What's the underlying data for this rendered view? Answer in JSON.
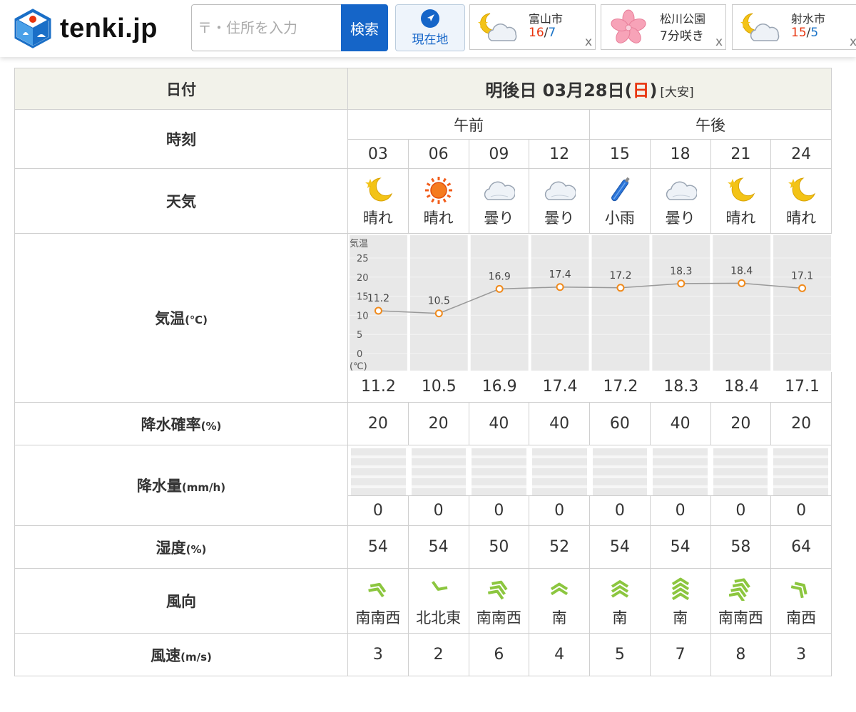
{
  "header": {
    "logo_text": "tenki.jp",
    "search": {
      "placeholder": "〒・住所を入力",
      "button_label": "検索"
    },
    "location_button_label": "現在地",
    "favorites": [
      {
        "name": "富山市",
        "high": "16",
        "sep": "/",
        "low": "7",
        "close": "x",
        "icon": "moon-cloud-icon"
      },
      {
        "name": "松川公園",
        "status": "7分咲き",
        "close": "x",
        "icon": "cherry-blossom-icon"
      },
      {
        "name": "射水市",
        "high": "15",
        "sep": "/",
        "low": "5",
        "close": "x",
        "icon": "moon-cloud-icon"
      }
    ]
  },
  "table": {
    "labels": {
      "date": "日付",
      "time": "時刻",
      "weather": "天気",
      "temp": "気温",
      "temp_unit": "(℃)",
      "precip_prob": "降水確率",
      "precip_prob_unit": "(%)",
      "precip_amount": "降水量",
      "precip_amount_unit": "(mm/h)",
      "humidity": "湿度",
      "humidity_unit": "(%)",
      "wind_dir": "風向",
      "wind_speed": "風速",
      "wind_speed_unit": "(m/s)"
    },
    "date": {
      "prefix": "明後日 03月28日(",
      "weekday": "日",
      "suffix": ")",
      "rokuyo": "[大安]"
    },
    "am_label": "午前",
    "pm_label": "午後",
    "hours": [
      "03",
      "06",
      "09",
      "12",
      "15",
      "18",
      "21",
      "24"
    ],
    "weather": [
      {
        "text": "晴れ",
        "icon": "moon-icon"
      },
      {
        "text": "晴れ",
        "icon": "sun-icon"
      },
      {
        "text": "曇り",
        "icon": "cloud-icon"
      },
      {
        "text": "曇り",
        "icon": "cloud-icon"
      },
      {
        "text": "小雨",
        "icon": "umbrella-icon"
      },
      {
        "text": "曇り",
        "icon": "cloud-icon"
      },
      {
        "text": "晴れ",
        "icon": "moon-icon"
      },
      {
        "text": "晴れ",
        "icon": "moon-icon"
      }
    ],
    "temps": [
      "11.2",
      "10.5",
      "16.9",
      "17.4",
      "17.2",
      "18.3",
      "18.4",
      "17.1"
    ],
    "precip_prob": [
      "20",
      "20",
      "40",
      "40",
      "60",
      "40",
      "20",
      "20"
    ],
    "precip_amount": [
      "0",
      "0",
      "0",
      "0",
      "0",
      "0",
      "0",
      "0"
    ],
    "humidity": [
      "54",
      "54",
      "50",
      "52",
      "54",
      "54",
      "58",
      "64"
    ],
    "wind_dir": [
      {
        "text": "南南西",
        "icon": "wind-arrow-icon",
        "strength": 3
      },
      {
        "text": "北北東",
        "icon": "wind-arrow-icon",
        "strength": 2
      },
      {
        "text": "南南西",
        "icon": "wind-arrow-icon",
        "strength": 6
      },
      {
        "text": "南",
        "icon": "wind-arrow-icon",
        "strength": 4
      },
      {
        "text": "南",
        "icon": "wind-arrow-icon",
        "strength": 5
      },
      {
        "text": "南",
        "icon": "wind-arrow-icon",
        "strength": 7
      },
      {
        "text": "南南西",
        "icon": "wind-arrow-icon",
        "strength": 8
      },
      {
        "text": "南西",
        "icon": "wind-arrow-icon",
        "strength": 3
      }
    ],
    "wind_speed": [
      "3",
      "2",
      "6",
      "4",
      "5",
      "7",
      "8",
      "3"
    ]
  },
  "chart_data": {
    "type": "line",
    "title": "",
    "ylabel": "気温",
    "yunit": "(℃)",
    "categories": [
      "03",
      "06",
      "09",
      "12",
      "15",
      "18",
      "21",
      "24"
    ],
    "values": [
      11.2,
      10.5,
      16.9,
      17.4,
      17.2,
      18.3,
      18.4,
      17.1
    ],
    "yticks": [
      "25",
      "20",
      "15",
      "10",
      "5",
      "0"
    ],
    "ylim": [
      0,
      25
    ],
    "grid": true,
    "colors": {
      "line": "#999999",
      "marker": "#f08a1c",
      "bg": "#e8e8e8"
    }
  }
}
